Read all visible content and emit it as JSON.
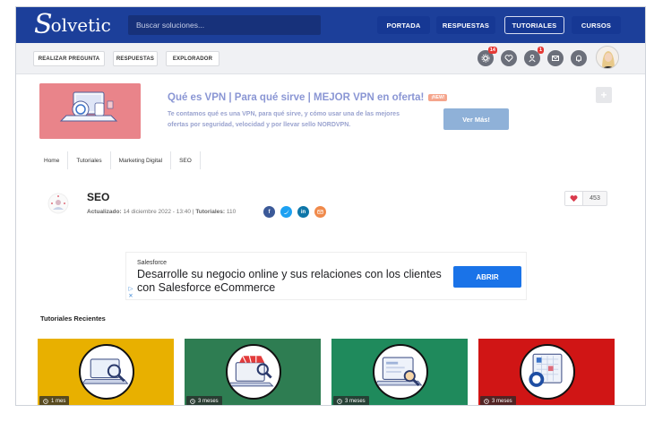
{
  "logo": {
    "initial": "S",
    "rest": "olvetic"
  },
  "search": {
    "placeholder": "Buscar soluciones..."
  },
  "nav": {
    "items": [
      {
        "label": "PORTADA"
      },
      {
        "label": "RESPUESTAS"
      },
      {
        "label": "TUTORIALES"
      },
      {
        "label": "CURSOS"
      }
    ],
    "active": "TUTORIALES"
  },
  "toolbar": {
    "buttons": [
      {
        "label": "REALIZAR PREGUNTA"
      },
      {
        "label": "RESPUESTAS"
      },
      {
        "label": "EXPLORADOR"
      }
    ],
    "badges": {
      "settings": "14",
      "user": "1"
    }
  },
  "promo": {
    "title": "Qué es VPN | Para qué sirve | MEJOR VPN en oferta!",
    "new_tag": "¡NEW!",
    "text": "Te contamos qué es una VPN, para qué sirve, y cómo usar una de las mejores ofertas por seguridad, velocidad y por llevar sello NORDVPN.",
    "button": "Ver Más!",
    "plus": "+"
  },
  "breadcrumb": [
    "Home",
    "Tutoriales",
    "Marketing Digital",
    "SEO"
  ],
  "category": {
    "title": "SEO",
    "updated_label": "Actualizado:",
    "updated_value": "14 diciembre 2022 - 13:40",
    "tutorials_label": "Tutoriales:",
    "tutorials_value": "110",
    "favorites": "453"
  },
  "ad": {
    "brand": "Salesforce",
    "text": "Desarrolle su negocio online y sus relaciones con los clientes con Salesforce eCommerce",
    "button": "ABRIR"
  },
  "recent": {
    "title": "Tutoriales Recientes",
    "cards": [
      {
        "time": "1 mes",
        "color": "#e8b000"
      },
      {
        "time": "3 meses",
        "color": "#2e7d52"
      },
      {
        "time": "3 meses",
        "color": "#1f8a5c"
      },
      {
        "time": "3 meses",
        "color": "#d01515"
      }
    ]
  },
  "colors": {
    "brand": "#1c3f9a",
    "accent": "#1a73e8"
  }
}
